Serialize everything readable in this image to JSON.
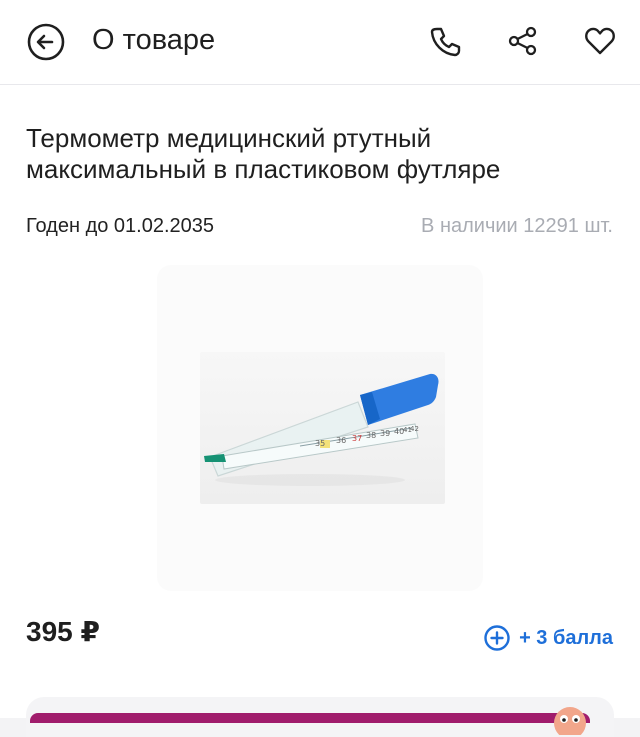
{
  "header": {
    "back_icon": "arrow-left-circle-icon",
    "title": "О товаре",
    "actions": [
      {
        "icon": "phone-icon"
      },
      {
        "icon": "share-icon"
      },
      {
        "icon": "heart-icon"
      }
    ]
  },
  "product": {
    "title": "Термометр медицинский ртутный максимальный в пластиковом футляре",
    "expiry": "Годен до 01.02.2035",
    "stock": "В наличии 12291 шт.",
    "image_icon": "thermometer-in-case-photo",
    "thermometer_scale": [
      "35",
      "36",
      "37",
      "38",
      "39",
      "40",
      "41",
      "42"
    ],
    "price": "395 ₽",
    "bonus": "+ 3 балла",
    "bonus_icon": "plus-circle-icon"
  },
  "colors": {
    "accent_blue": "#1e6fd9",
    "cart_bar": "#a01c6c",
    "stock_gray": "#a9acb3"
  }
}
